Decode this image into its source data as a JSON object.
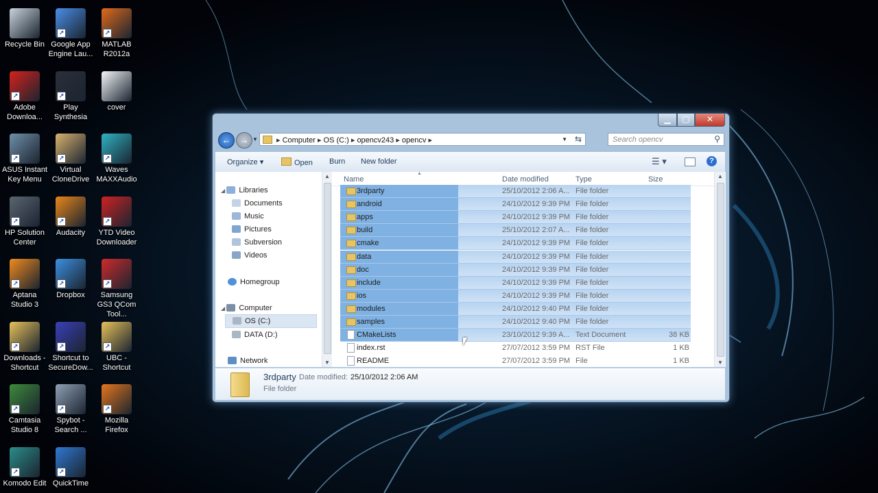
{
  "desktop": {
    "icons": [
      {
        "label": "Recycle Bin",
        "icon": "recycle-bin-icon",
        "color": "#c9d3dc",
        "shortcut": false
      },
      {
        "label": "Google App Engine Lau...",
        "icon": "google-app-engine-icon",
        "color": "#4a8ee8",
        "shortcut": true
      },
      {
        "label": "MATLAB R2012a",
        "icon": "matlab-icon",
        "color": "#e06a1b",
        "shortcut": true
      },
      {
        "label": "Adobe Downloa...",
        "icon": "adobe-icon",
        "color": "#d7211b",
        "shortcut": true
      },
      {
        "label": "Play Synthesia",
        "icon": "synthesia-icon",
        "color": "#2b2f3a",
        "shortcut": true
      },
      {
        "label": "cover",
        "icon": "document-icon",
        "color": "#f4f6f9",
        "shortcut": false
      },
      {
        "label": "ASUS Instant Key Menu",
        "icon": "asus-icon",
        "color": "#6f8fa8",
        "shortcut": true
      },
      {
        "label": "Virtual CloneDrive",
        "icon": "clonedrive-icon",
        "color": "#d8b26e",
        "shortcut": true
      },
      {
        "label": "Waves MAXXAudio",
        "icon": "waves-icon",
        "color": "#2fb3c4",
        "shortcut": true
      },
      {
        "label": "HP Solution Center",
        "icon": "hp-icon",
        "color": "#5b6570",
        "shortcut": true
      },
      {
        "label": "Audacity",
        "icon": "audacity-icon",
        "color": "#e8861b",
        "shortcut": true
      },
      {
        "label": "YTD Video Downloader",
        "icon": "ytd-icon",
        "color": "#cf2222",
        "shortcut": true
      },
      {
        "label": "Aptana Studio 3",
        "icon": "aptana-icon",
        "color": "#f08a1f",
        "shortcut": true
      },
      {
        "label": "Dropbox",
        "icon": "dropbox-icon",
        "color": "#3c8fe0",
        "shortcut": true
      },
      {
        "label": "Samsung GS3 QCom Tool...",
        "icon": "samsung-tool-icon",
        "color": "#cf2a2a",
        "shortcut": true
      },
      {
        "label": "Downloads - Shortcut",
        "icon": "downloads-folder-icon",
        "color": "#e6c15a",
        "shortcut": true
      },
      {
        "label": "Shortcut to SecureDow...",
        "icon": "securedownload-icon",
        "color": "#3a3fb7",
        "shortcut": true
      },
      {
        "label": "UBC - Shortcut",
        "icon": "folder-icon",
        "color": "#e6c15a",
        "shortcut": true
      },
      {
        "label": "Camtasia Studio 8",
        "icon": "camtasia-icon",
        "color": "#3d8a3a",
        "shortcut": true
      },
      {
        "label": "Spybot - Search ...",
        "icon": "spybot-icon",
        "color": "#8f9fb5",
        "shortcut": true
      },
      {
        "label": "Mozilla Firefox",
        "icon": "firefox-icon",
        "color": "#e5761c",
        "shortcut": true
      },
      {
        "label": "Komodo Edit",
        "icon": "komodo-icon",
        "color": "#2b8d8a",
        "shortcut": true
      },
      {
        "label": "QuickTime",
        "icon": "quicktime-icon",
        "color": "#2f78d0",
        "shortcut": true
      }
    ]
  },
  "window": {
    "breadcrumb": [
      "Computer",
      "OS (C:)",
      "opencv243",
      "opencv"
    ],
    "search_placeholder": "Search opencv",
    "toolbar": {
      "organize": "Organize",
      "open": "Open",
      "burn": "Burn",
      "new_folder": "New folder"
    },
    "nav": {
      "libraries": "Libraries",
      "library_items": [
        "Documents",
        "Music",
        "Pictures",
        "Subversion",
        "Videos"
      ],
      "homegroup": "Homegroup",
      "computer": "Computer",
      "drives": [
        "OS (C:)",
        "DATA (D:)"
      ],
      "network": "Network"
    },
    "columns": {
      "name": "Name",
      "date": "Date modified",
      "type": "Type",
      "size": "Size"
    },
    "files": [
      {
        "name": "3rdparty",
        "date": "25/10/2012 2:06 A...",
        "type": "File folder",
        "size": "",
        "kind": "folder",
        "selected": true
      },
      {
        "name": "android",
        "date": "24/10/2012 9:39 PM",
        "type": "File folder",
        "size": "",
        "kind": "folder",
        "selected": true
      },
      {
        "name": "apps",
        "date": "24/10/2012 9:39 PM",
        "type": "File folder",
        "size": "",
        "kind": "folder",
        "selected": true
      },
      {
        "name": "build",
        "date": "25/10/2012 2:07 A...",
        "type": "File folder",
        "size": "",
        "kind": "folder",
        "selected": true
      },
      {
        "name": "cmake",
        "date": "24/10/2012 9:39 PM",
        "type": "File folder",
        "size": "",
        "kind": "folder",
        "selected": true
      },
      {
        "name": "data",
        "date": "24/10/2012 9:39 PM",
        "type": "File folder",
        "size": "",
        "kind": "folder",
        "selected": true
      },
      {
        "name": "doc",
        "date": "24/10/2012 9:39 PM",
        "type": "File folder",
        "size": "",
        "kind": "folder",
        "selected": true
      },
      {
        "name": "include",
        "date": "24/10/2012 9:39 PM",
        "type": "File folder",
        "size": "",
        "kind": "folder",
        "selected": true
      },
      {
        "name": "ios",
        "date": "24/10/2012 9:39 PM",
        "type": "File folder",
        "size": "",
        "kind": "folder",
        "selected": true
      },
      {
        "name": "modules",
        "date": "24/10/2012 9:40 PM",
        "type": "File folder",
        "size": "",
        "kind": "folder",
        "selected": true
      },
      {
        "name": "samples",
        "date": "24/10/2012 9:40 PM",
        "type": "File folder",
        "size": "",
        "kind": "folder",
        "selected": true
      },
      {
        "name": "CMakeLists",
        "date": "23/10/2012 9:39 A...",
        "type": "Text Document",
        "size": "38 KB",
        "kind": "file",
        "selected": true
      },
      {
        "name": "index.rst",
        "date": "27/07/2012 3:59 PM",
        "type": "RST File",
        "size": "1 KB",
        "kind": "file",
        "selected": false
      },
      {
        "name": "README",
        "date": "27/07/2012 3:59 PM",
        "type": "File",
        "size": "1 KB",
        "kind": "file",
        "selected": false
      }
    ],
    "details": {
      "name": "3rdparty",
      "date_label": "Date modified:",
      "date": "25/10/2012 2:06 AM",
      "type": "File folder"
    }
  },
  "colors": {
    "selection": "#b8d4f1",
    "selection_strong": "#7fb1e3",
    "accent": "#1e395b",
    "close": "#c9412f"
  }
}
